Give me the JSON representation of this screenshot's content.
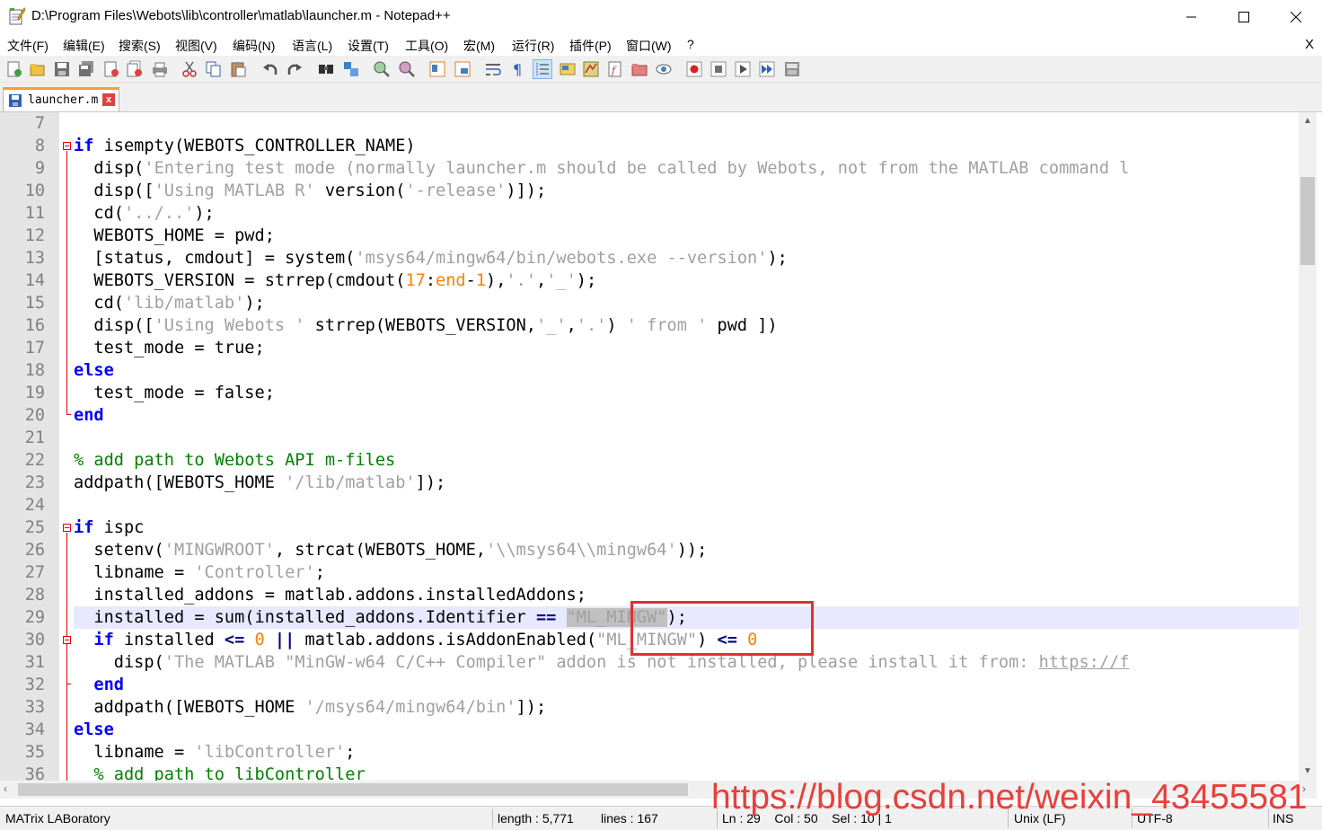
{
  "window": {
    "title": "D:\\Program Files\\Webots\\lib\\controller\\matlab\\launcher.m - Notepad++"
  },
  "menu": {
    "items": [
      "文件(F)",
      "编辑(E)",
      "搜索(S)",
      "视图(V)",
      "编码(N)",
      "语言(L)",
      "设置(T)",
      "工具(O)",
      "宏(M)",
      "运行(R)",
      "插件(P)",
      "窗口(W)",
      "?"
    ],
    "close_label": "X"
  },
  "tab": {
    "label": "launcher.m",
    "close_label": "x"
  },
  "editor": {
    "current_line": 29,
    "lines": [
      {
        "n": "7"
      },
      {
        "n": "8"
      },
      {
        "n": "9"
      },
      {
        "n": "10"
      },
      {
        "n": "11"
      },
      {
        "n": "12"
      },
      {
        "n": "13"
      },
      {
        "n": "14"
      },
      {
        "n": "15"
      },
      {
        "n": "16"
      },
      {
        "n": "17"
      },
      {
        "n": "18"
      },
      {
        "n": "19"
      },
      {
        "n": "20"
      },
      {
        "n": "21"
      },
      {
        "n": "22"
      },
      {
        "n": "23"
      },
      {
        "n": "24"
      },
      {
        "n": "25"
      },
      {
        "n": "26"
      },
      {
        "n": "27"
      },
      {
        "n": "28"
      },
      {
        "n": "29"
      },
      {
        "n": "30"
      },
      {
        "n": "31"
      },
      {
        "n": "32"
      },
      {
        "n": "33"
      },
      {
        "n": "34"
      },
      {
        "n": "35"
      },
      {
        "n": "36"
      }
    ],
    "code": {
      "l8_kw": "if",
      "l8_rest": " isempty(WEBOTS_CONTROLLER_NAME)",
      "l9_a": "  disp(",
      "l9_str": "'Entering test mode (normally launcher.m should be called by Webots, not from the MATLAB command l",
      "l10_a": "  disp([",
      "l10_str1": "'Using MATLAB R'",
      "l10_b": " version(",
      "l10_str2": "'-release'",
      "l10_c": ")]);",
      "l11_a": "  cd(",
      "l11_str": "'../..'",
      "l11_b": ");",
      "l12": "  WEBOTS_HOME = pwd;",
      "l13_a": "  [status, cmdout] = system(",
      "l13_str": "'msys64/mingw64/bin/webots.exe --version'",
      "l13_b": ");",
      "l14_a": "  WEBOTS_VERSION = strrep(cmdout(",
      "l14_n1": "17",
      "l14_b": ":",
      "l14_end": "end",
      "l14_c": "-",
      "l14_n2": "1",
      "l14_d": "),",
      "l14_str1": "'.'",
      "l14_e": ",",
      "l14_str2": "'_'",
      "l14_f": ");",
      "l15_a": "  cd(",
      "l15_str": "'lib/matlab'",
      "l15_b": ");",
      "l16_a": "  disp([",
      "l16_str1": "'Using Webots '",
      "l16_b": " strrep(WEBOTS_VERSION,",
      "l16_str2": "'_'",
      "l16_c": ",",
      "l16_str3": "'.'",
      "l16_d": ") ",
      "l16_str4": "' from '",
      "l16_e": " pwd ])",
      "l17": "  test_mode = true;",
      "l18_kw": "else",
      "l19": "  test_mode = false;",
      "l20_kw": "end",
      "l22_cmt": "% add path to Webots API m-files",
      "l23_a": "addpath([WEBOTS_HOME ",
      "l23_str": "'/lib/matlab'",
      "l23_b": "]);",
      "l25_kw": "if",
      "l25_rest": " ispc",
      "l26_a": "  setenv(",
      "l26_str1": "'MINGWROOT'",
      "l26_b": ", strcat(WEBOTS_HOME,",
      "l26_str2": "'\\\\msys64\\\\mingw64'",
      "l26_c": "));",
      "l27_a": "  libname = ",
      "l27_str": "'Controller'",
      "l27_b": ";",
      "l28": "  installed_addons = matlab.addons.installedAddons;",
      "l29_a": "  installed = sum(installed_addons.Identifier ",
      "l29_op": "==",
      "l29_sp": " ",
      "l29_str": "\"ML_MINGW\"",
      "l29_b": ");",
      "l30_sp": "  ",
      "l30_kw": "if",
      "l30_a": " installed ",
      "l30_op1": "<=",
      "l30_sp2": " ",
      "l30_n": "0",
      "l30_sp3": " ",
      "l30_op2": "||",
      "l30_b": " matlab.addons.isAddonEnabled(",
      "l30_str": "\"ML_MINGW\"",
      "l30_c": ") ",
      "l30_op3": "<=",
      "l30_sp4": " ",
      "l30_n2": "0",
      "l31_a": "    disp(",
      "l31_str": "'The MATLAB \"MinGW-w64 C/C++ Compiler\" addon is not installed, please install it from: ",
      "l31_link": "https://f",
      "l32_sp": "  ",
      "l32_kw": "end",
      "l33_a": "  addpath([WEBOTS_HOME ",
      "l33_str": "'/msys64/mingw64/bin'",
      "l33_b": "]);",
      "l34_kw": "else",
      "l35_a": "  libname = ",
      "l35_str": "'libController'",
      "l35_b": ";",
      "l36_cmt": "  % add path to libController"
    }
  },
  "statusbar": {
    "language": "MATrix LABoratory",
    "length": "length : 5,771",
    "lines": "lines : 167",
    "position": "Ln : 29    Col : 50    Sel : 10 | 1",
    "eol": "Unix (LF)",
    "encoding": "UTF-8",
    "mode": "INS"
  },
  "watermark": "https://blog.csdn.net/weixin_43455581",
  "colors": {
    "keyword": "#0000ff",
    "string": "#a0a0a0",
    "number": "#ff8000",
    "comment": "#008000",
    "annotation": "#e03030"
  }
}
